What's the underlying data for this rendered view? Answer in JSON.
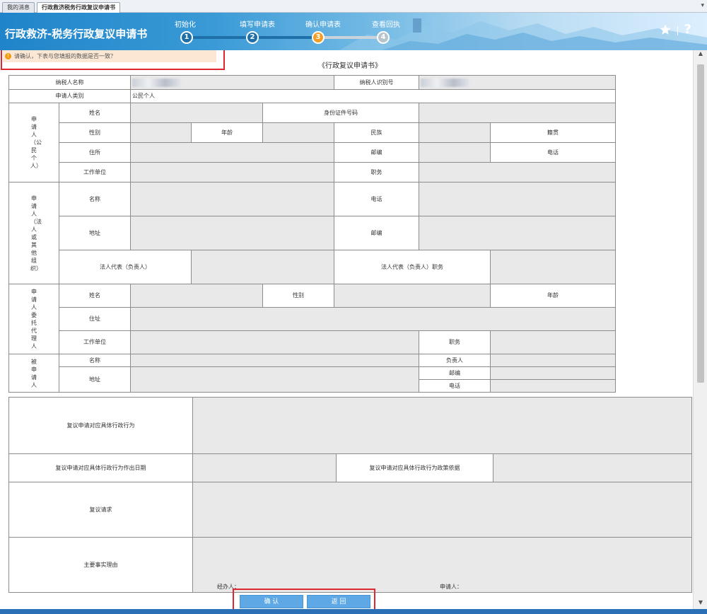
{
  "tabs": [
    {
      "label": "我的消息"
    },
    {
      "label": "行政救济税务行政复议申请书"
    }
  ],
  "tab_menu_glyph": "▾",
  "banner": {
    "title": "行政救济-税务行政复议申请书",
    "steps": [
      {
        "num": "1",
        "label": "初始化",
        "color": "#1f6fa8"
      },
      {
        "num": "2",
        "label": "填写申请表",
        "color": "#1f6fa8"
      },
      {
        "num": "3",
        "label": "确认申请表",
        "color": "#f39c26"
      },
      {
        "num": "4",
        "label": "查看回执",
        "color": "#b8c4cc"
      }
    ],
    "star_icon": "★",
    "help_icon": "?"
  },
  "notice": {
    "icon": "!",
    "text": "请确认，下表与您填报的数据是否一致？"
  },
  "document_title": "《行政复议申请书》",
  "form": {
    "taxpayer_name_label": "纳税人名称",
    "taxpayer_id_label": "纳税人识别号",
    "applicant_type_label": "申请人类别",
    "applicant_type_value": "公民个人",
    "section_citizen": "申请人（公民个人）",
    "name_label": "姓名",
    "id_number_label": "身份证件号码",
    "gender_label": "性别",
    "age_label": "年龄",
    "ethnicity_label": "民族",
    "origin_label": "籍贯",
    "address_label": "住所",
    "postcode_label": "邮编",
    "phone_label": "电话",
    "employer_label": "工作单位",
    "position_label": "职务",
    "section_legal": "申请人（法人或其他组织）",
    "org_name_label": "名称",
    "org_phone_label": "电话",
    "org_address_label": "地址",
    "org_postcode_label": "邮编",
    "legal_rep_label": "法人代表（负责人）",
    "legal_rep_position_label": "法人代表（负责人）职务",
    "section_agent": "申请人委托代理人",
    "agent_name_label": "姓名",
    "agent_gender_label": "性别",
    "agent_age_label": "年龄",
    "agent_address_label": "住址",
    "agent_employer_label": "工作单位",
    "agent_position_label": "职务",
    "section_respondent": "被申请人",
    "resp_name_label": "名称",
    "resp_head_label": "负责人",
    "resp_address_label": "地址",
    "resp_postcode_label": "邮编",
    "resp_phone_label": "电话",
    "action_label": "复议申请对应具体行政行为",
    "action_date_label": "复议申请对应具体行政行为作出日期",
    "policy_basis_label": "复议申请对应具体行政行为政策依据",
    "request_label": "复议请求",
    "facts_label": "主要事实理由",
    "handler_label": "经办人：",
    "applicant_sign_label": "申请人："
  },
  "buttons": {
    "confirm": "确 认",
    "back": "返 回"
  },
  "scroll": {
    "up": "▲",
    "down": "▼"
  },
  "colors": {
    "banner": "#1f84c9",
    "highlight": "#e0262e",
    "button": "#5ea8e6",
    "value_cell": "#e9e9e9"
  }
}
